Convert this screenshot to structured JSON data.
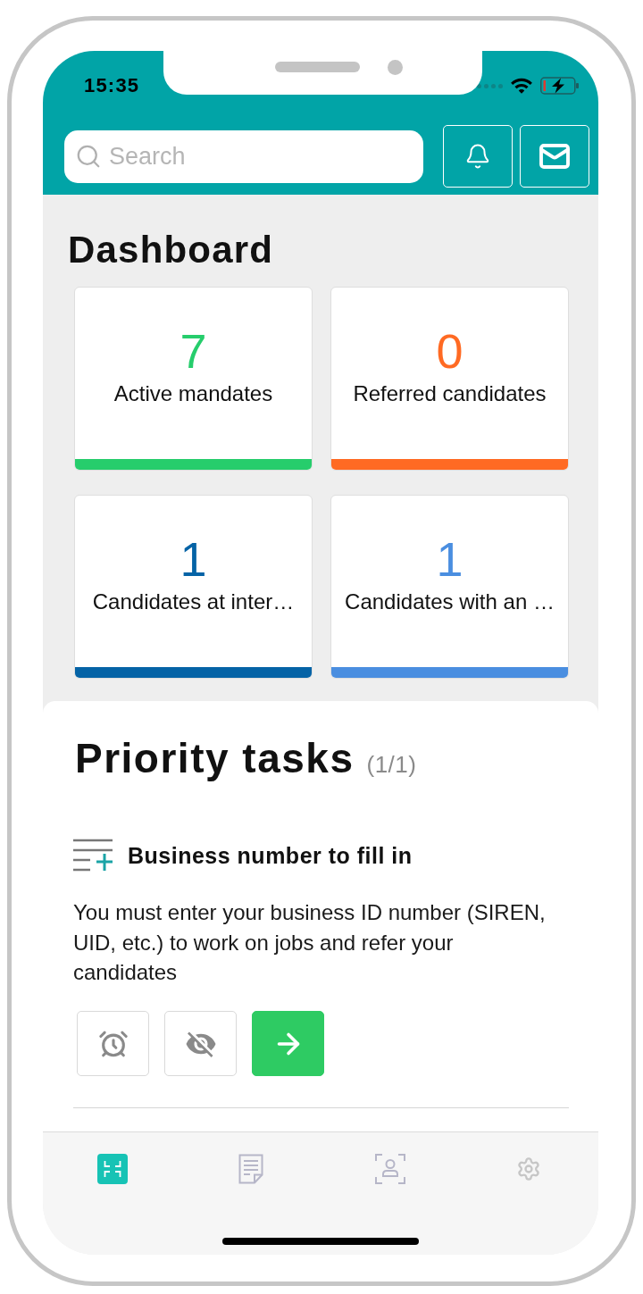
{
  "status_bar": {
    "time": "15:35"
  },
  "header": {
    "search": {
      "placeholder": "Search"
    }
  },
  "dashboard": {
    "title": "Dashboard",
    "cards": [
      {
        "value": "7",
        "label": "Active mandates",
        "color": "#26cd6c"
      },
      {
        "value": "0",
        "label": "Referred candidates",
        "color": "#ff6a23"
      },
      {
        "value": "1",
        "label": "Candidates at inter…",
        "color": "#0563a6"
      },
      {
        "value": "1",
        "label": "Candidates with an …",
        "color": "#4a8ee0"
      }
    ]
  },
  "priority_tasks": {
    "title": "Priority tasks",
    "count": "(1/1)",
    "tasks": [
      {
        "title": "Business number to fill in",
        "description": "You must enter your business ID number (SIREN, UID, etc.) to work on jobs and refer your candidates",
        "actions": [
          {
            "kind": "snooze"
          },
          {
            "kind": "hide"
          },
          {
            "kind": "go"
          }
        ]
      }
    ]
  },
  "tab_bar": {
    "tabs": [
      {
        "kind": "dashboard",
        "selected": true
      },
      {
        "kind": "documents",
        "selected": false
      },
      {
        "kind": "candidates",
        "selected": false
      },
      {
        "kind": "settings",
        "selected": false
      }
    ]
  }
}
